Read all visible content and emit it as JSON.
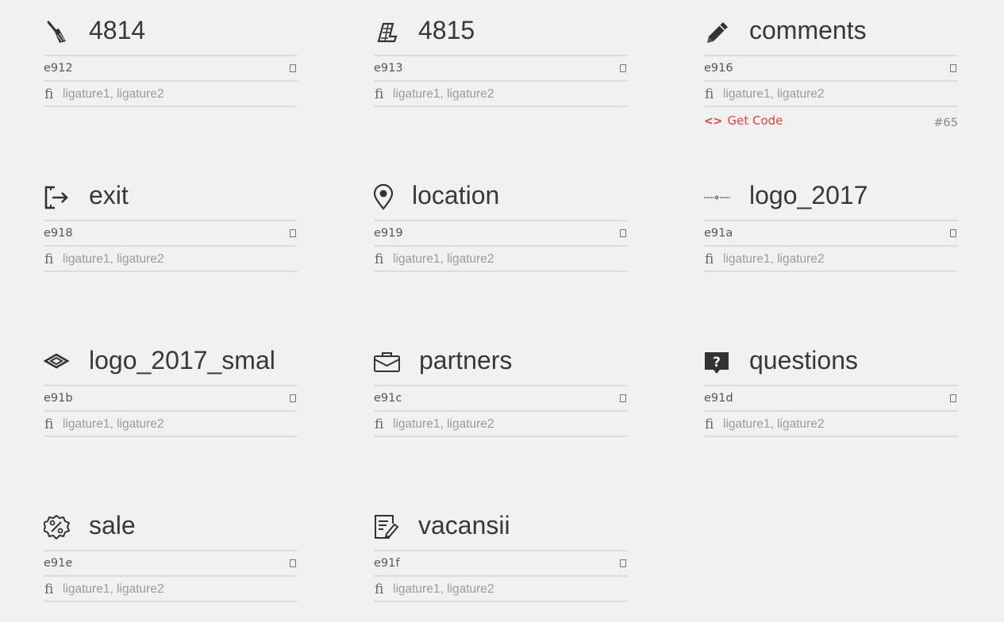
{
  "glyphs": [
    {
      "name": "4814",
      "code": "e912",
      "ligatures": "ligature1, ligature2",
      "icon": "broom-icon"
    },
    {
      "name": "4815",
      "code": "e913",
      "ligatures": "ligature1, ligature2",
      "icon": "wall-icon"
    },
    {
      "name": "comments",
      "code": "e916",
      "ligatures": "ligature1, ligature2",
      "icon": "pencil-icon",
      "get_code": "Get Code",
      "number": "#65"
    },
    {
      "name": "exit",
      "code": "e918",
      "ligatures": "ligature1, ligature2",
      "icon": "exit-icon"
    },
    {
      "name": "location",
      "code": "e919",
      "ligatures": "ligature1, ligature2",
      "icon": "location-pin-icon"
    },
    {
      "name": "logo_2017",
      "code": "e91a",
      "ligatures": "ligature1, ligature2",
      "icon": "logo-wordmark-icon"
    },
    {
      "name": "logo_2017_smal",
      "code": "e91b",
      "ligatures": "ligature1, ligature2",
      "icon": "logo-diamond-icon"
    },
    {
      "name": "partners",
      "code": "e91c",
      "ligatures": "ligature1, ligature2",
      "icon": "briefcase-icon"
    },
    {
      "name": "questions",
      "code": "e91d",
      "ligatures": "ligature1, ligature2",
      "icon": "question-bubble-icon"
    },
    {
      "name": "sale",
      "code": "e91e",
      "ligatures": "ligature1, ligature2",
      "icon": "percent-badge-icon"
    },
    {
      "name": "vacansii",
      "code": "e91f",
      "ligatures": "ligature1, ligature2",
      "icon": "document-pen-icon"
    }
  ],
  "ligature_glyph": "ﬁ",
  "colors": {
    "background": "#f1f1f1",
    "accent": "#e0413a",
    "divider": "#dcdcdc"
  }
}
